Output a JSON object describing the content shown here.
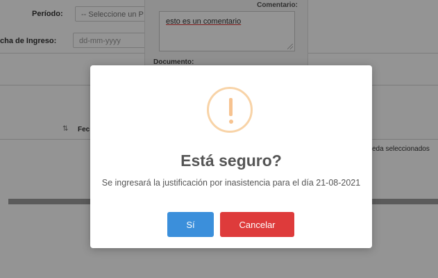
{
  "background_form": {
    "periodo_label": "Período:",
    "periodo_select_value": "-- Seleccione un P",
    "fecha_ingreso_label": "cha de Ingreso:",
    "fecha_ingreso_placeholder": "dd-mm-yyyy",
    "table_header_partial": "Fec",
    "table_sort_glyph": "⇅",
    "right_note": "eda seleccionados"
  },
  "comment_panel": {
    "title": "Comentario:",
    "textarea_value": "esto es un comentario",
    "document_label": "Documento:"
  },
  "modal": {
    "icon": "warning-exclamation-icon",
    "icon_color": "#f8bb86",
    "title": "Está seguro?",
    "message": "Se ingresará la justificación por inasistencia para el día 21-08-2021",
    "confirm_label": "Sí",
    "confirm_color": "#3b8fdb",
    "cancel_label": "Cancelar",
    "cancel_color": "#de3b3b"
  }
}
